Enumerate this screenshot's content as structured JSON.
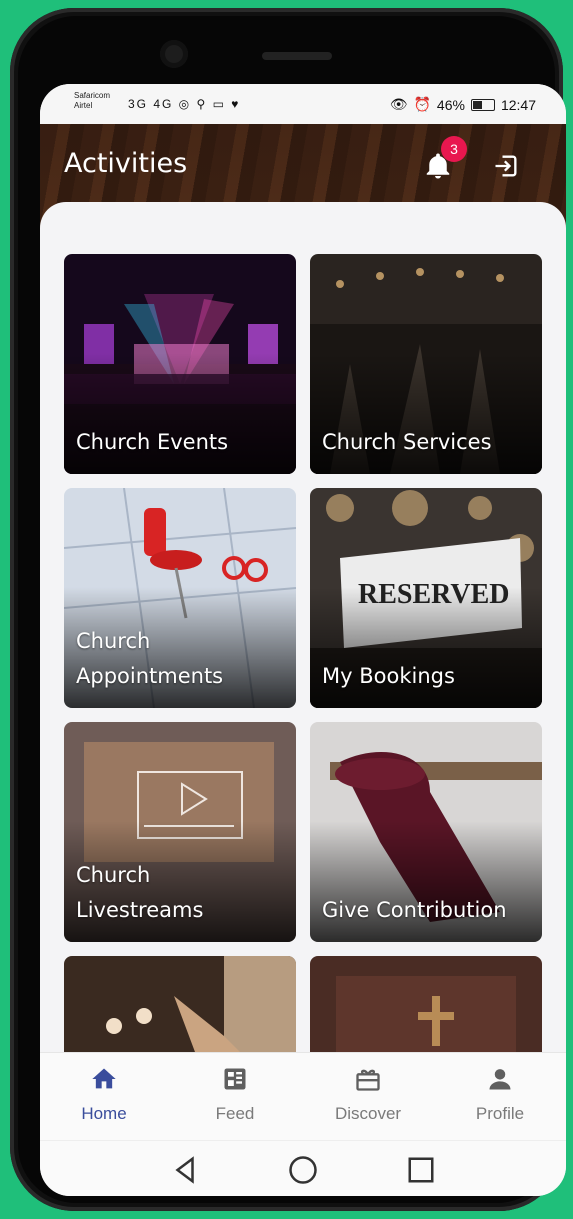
{
  "status": {
    "carrier_top": "Safaricom",
    "carrier_bottom": "Airtel",
    "network_icons": "3G  4G  ◎ ⚲ ▭ ♥",
    "battery_percent": "46%",
    "time": "12:47"
  },
  "header": {
    "title": "Activities",
    "notification_count": "3"
  },
  "cards": [
    {
      "label": "Church Events"
    },
    {
      "label": "Church Services"
    },
    {
      "label": "Church\nAppointments"
    },
    {
      "label": "My Bookings"
    },
    {
      "label": "Church\nLivestreams"
    },
    {
      "label": "Give Contribution"
    },
    {
      "label": ""
    },
    {
      "label": ""
    }
  ],
  "nav": {
    "home": "Home",
    "feed": "Feed",
    "discover": "Discover",
    "profile": "Profile"
  },
  "colors": {
    "accent": "#3a4d9c",
    "badge": "#e8174f",
    "background": "#1fbf7a"
  },
  "reserved_sign": "RESERVED"
}
